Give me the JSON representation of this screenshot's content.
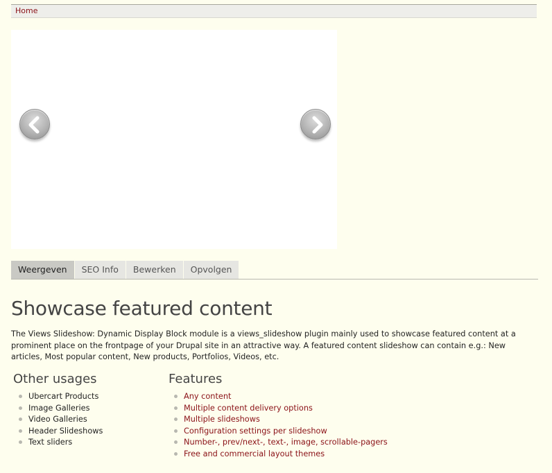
{
  "breadcrumb": {
    "home_label": "Home"
  },
  "slideshow": {
    "prev_icon": "chevron-left-icon",
    "next_icon": "chevron-right-icon"
  },
  "tabs": [
    {
      "label": "Weergeven",
      "active": true
    },
    {
      "label": "SEO Info",
      "active": false
    },
    {
      "label": "Bewerken",
      "active": false
    },
    {
      "label": "Opvolgen",
      "active": false
    }
  ],
  "content": {
    "title": "Showcase featured content",
    "intro": "The Views Slideshow: Dynamic Display Block module is a views_slideshow plugin mainly used to showcase featured content at a prominent place on the frontpage of your Drupal site in an attractive way. A featured content slideshow can contain e.g.: New articles, Most popular content, New products, Portfolios, Videos, etc.",
    "other_usages": {
      "heading": "Other usages",
      "items": [
        "Ubercart Products",
        "Image Galleries",
        "Video Galleries",
        "Header Slideshows",
        "Text sliders"
      ]
    },
    "features": {
      "heading": "Features",
      "items": [
        "Any content",
        "Multiple content delivery options",
        "Multiple slideshows",
        "Configuration settings per slideshow",
        "Number-, prev/next-, text-, image, scrollable-pagers",
        "Free and commercial layout themes"
      ]
    }
  },
  "colors": {
    "background": "#fefeee",
    "link": "#8a1016",
    "active_tab": "#c9c9c4",
    "inactive_tab": "#e6e6e2"
  }
}
